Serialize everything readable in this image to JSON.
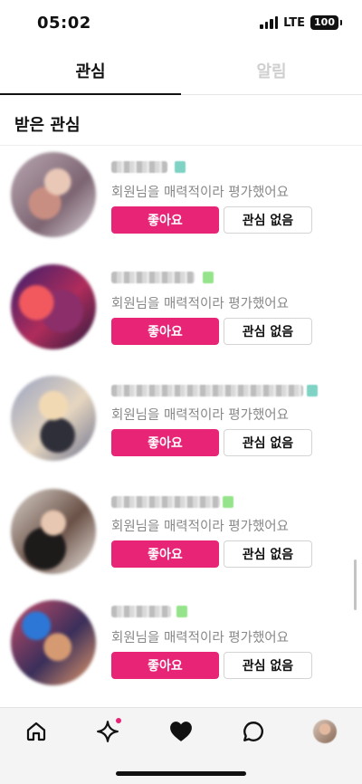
{
  "status_bar": {
    "time": "05:02",
    "network": "LTE",
    "battery": "100"
  },
  "tabs": [
    {
      "label": "관심",
      "active": true
    },
    {
      "label": "알림",
      "active": false
    }
  ],
  "section": {
    "title": "받은 관심"
  },
  "cards": [
    {
      "description": "회원님을 매력적이라 평가했어요",
      "like_label": "좋아요",
      "pass_label": "관심 없음"
    },
    {
      "description": "회원님을 매력적이라 평가했어요",
      "like_label": "좋아요",
      "pass_label": "관심 없음"
    },
    {
      "description": "회원님을 매력적이라 평가했어요",
      "like_label": "좋아요",
      "pass_label": "관심 없음"
    },
    {
      "description": "회원님을 매력적이라 평가했어요",
      "like_label": "좋아요",
      "pass_label": "관심 없음"
    },
    {
      "description": "회원님을 매력적이라 평가했어요",
      "like_label": "좋아요",
      "pass_label": "관심 없음"
    }
  ],
  "colors": {
    "accent": "#e82477",
    "muted_text": "#888888",
    "inactive_tab": "#cfcfcf"
  },
  "bottom_nav": {
    "icons": [
      "home-icon",
      "sparkle-icon",
      "heart-icon",
      "chat-icon",
      "profile-avatar"
    ],
    "notification_dot_on": "sparkle-icon"
  }
}
